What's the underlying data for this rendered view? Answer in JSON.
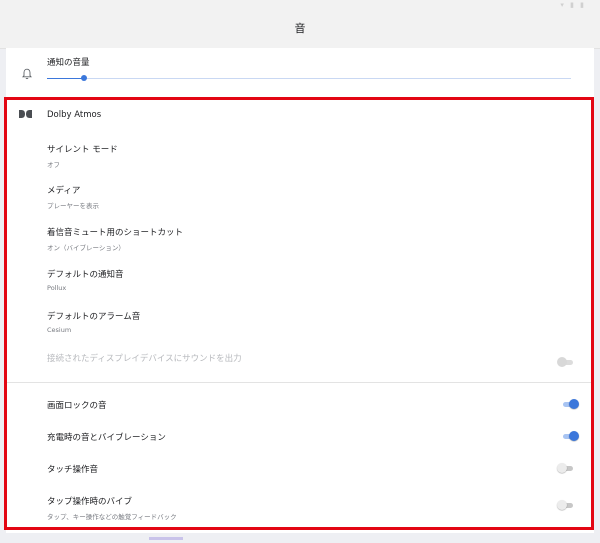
{
  "status_bar": {
    "icons": "▾ ▮ ▮"
  },
  "app_bar": {
    "title": "音"
  },
  "notification_volume": {
    "label": "通知の音量",
    "level_fraction": 0.07
  },
  "settings": {
    "dolby": {
      "label": "Dolby Atmos"
    },
    "silent_mode": {
      "title": "サイレント モード",
      "value": "オフ"
    },
    "media": {
      "title": "メディア",
      "value": "プレーヤーを表示"
    },
    "mute_shortcut": {
      "title": "着信音ミュート用のショートカット",
      "value": "オン（バイブレーション）"
    },
    "default_notification": {
      "title": "デフォルトの通知音",
      "value": "Pollux"
    },
    "default_alarm": {
      "title": "デフォルトのアラーム音",
      "value": "Cesium"
    },
    "cast_display": {
      "title": "接続されたディスプレイデバイスにサウンドを出力",
      "enabled": false,
      "on": false
    }
  },
  "toggles": {
    "screen_lock": {
      "title": "画面ロックの音",
      "on": true
    },
    "charging": {
      "title": "充電時の音とバイブレーション",
      "on": true
    },
    "touch": {
      "title": "タッチ操作音",
      "on": false
    },
    "tap_vibrate": {
      "title": "タップ操作時のバイブ",
      "subtitle": "タップ、キー操作などの触覚フィードバック",
      "on": false
    }
  },
  "colors": {
    "accent": "#3b77db",
    "highlight": "#e30613"
  }
}
